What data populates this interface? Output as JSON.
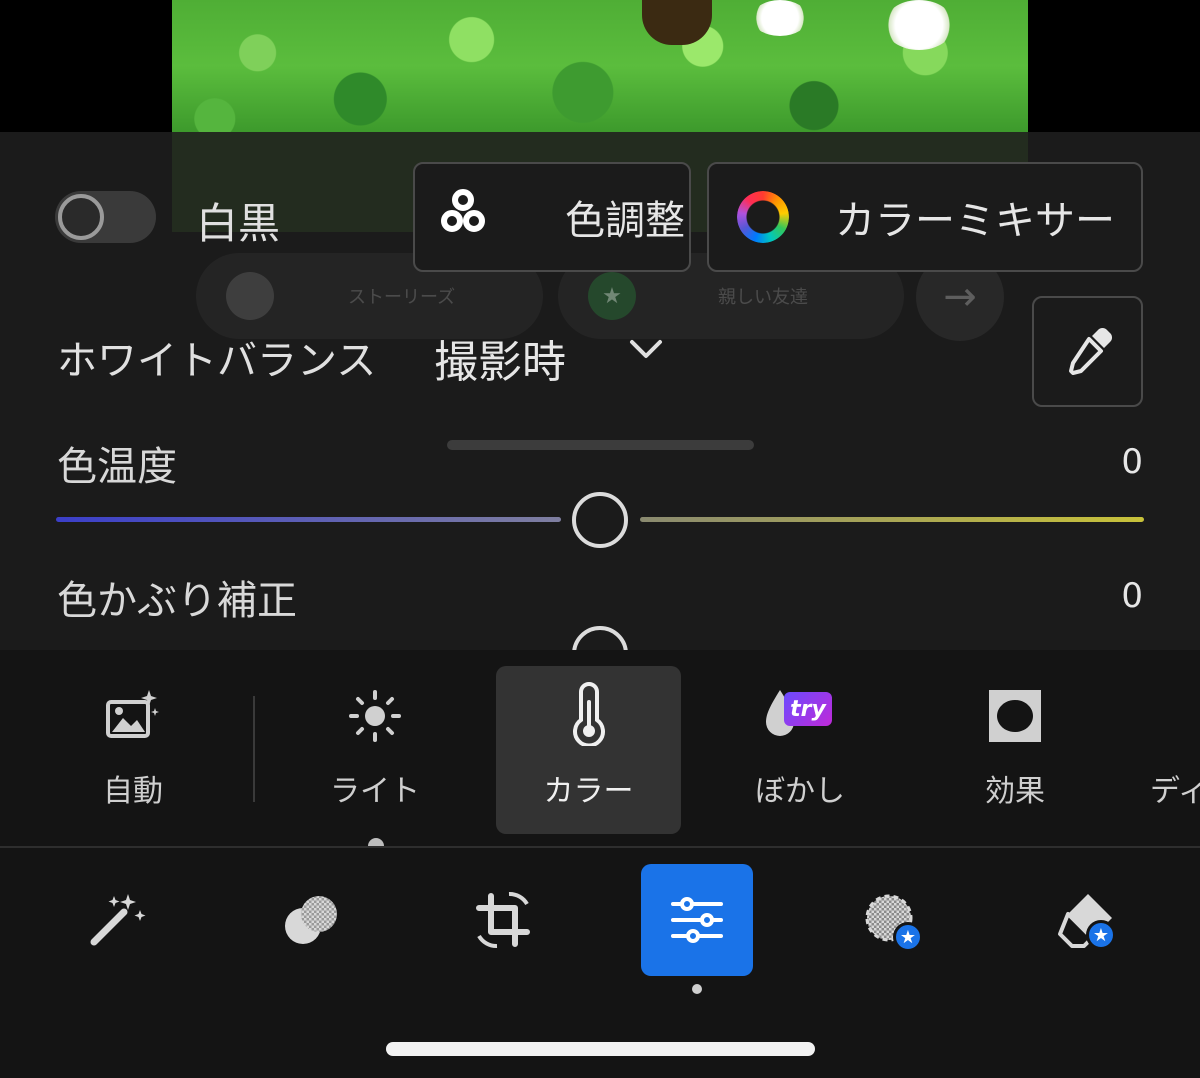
{
  "ghost": {
    "stories_label": "ストーリーズ",
    "close_friends_label": "親しい友達",
    "arrow_glyph": "→",
    "star_glyph": "★"
  },
  "panel": {
    "bw_label": "白黒",
    "bw_enabled": false,
    "color_adjust_label": "色調整",
    "color_mixer_label": "カラーミキサー",
    "white_balance_label": "ホワイトバランス",
    "white_balance_value": "撮影時",
    "sliders": [
      {
        "label": "色温度",
        "value": "0"
      },
      {
        "label": "色かぶり補正",
        "value": "0"
      }
    ]
  },
  "categories": [
    {
      "id": "auto",
      "label": "自動",
      "icon": "auto-enhance-image-icon"
    },
    {
      "id": "light",
      "label": "ライト",
      "icon": "sun-icon"
    },
    {
      "id": "color",
      "label": "カラー",
      "icon": "thermometer-icon",
      "selected": true
    },
    {
      "id": "blur",
      "label": "ぼかし",
      "icon": "drop-icon",
      "badge": "try"
    },
    {
      "id": "effect",
      "label": "効果",
      "icon": "vignette-icon"
    },
    {
      "id": "detail",
      "label": "ディ",
      "icon": "detail-icon"
    }
  ],
  "tools": [
    {
      "id": "enhance",
      "icon": "magic-wand-icon"
    },
    {
      "id": "overlay",
      "icon": "overlay-circles-icon"
    },
    {
      "id": "crop",
      "icon": "crop-rotate-icon"
    },
    {
      "id": "adjust",
      "icon": "sliders-icon",
      "selected": true
    },
    {
      "id": "select",
      "icon": "selection-brush-icon",
      "badge": "star"
    },
    {
      "id": "erase",
      "icon": "eraser-icon",
      "badge": "star"
    }
  ],
  "colors": {
    "accent": "#1a73e8",
    "panel_bg": "#1b1b1b",
    "toolbar_bg": "#141414",
    "temp_cool": "#3b3fc9",
    "temp_warm": "#c8c23a"
  }
}
